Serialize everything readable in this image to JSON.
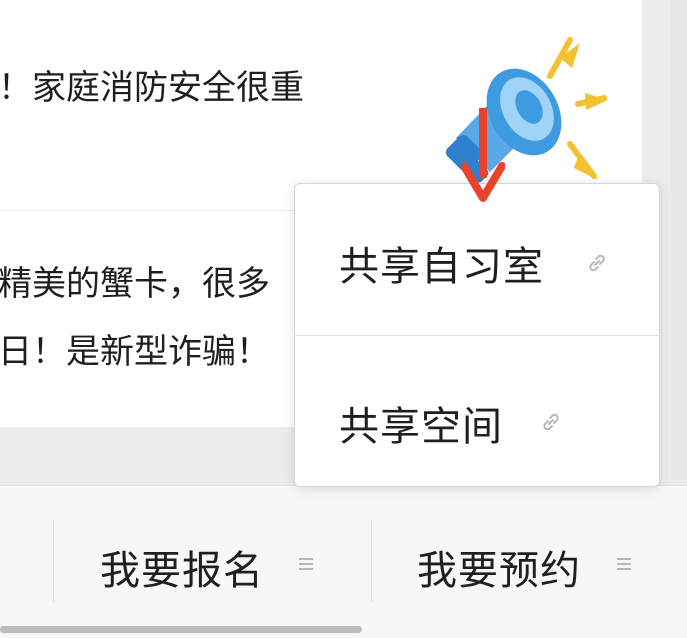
{
  "articles": [
    {
      "lines": [
        "！家庭消防安全很重"
      ]
    },
    {
      "lines": [
        "精美的蟹卡，很多",
        "日！是新型诈骗！"
      ]
    }
  ],
  "popup": {
    "items": [
      {
        "label": "共享自习室",
        "icon": "link-icon"
      },
      {
        "label": "共享空间",
        "icon": "link-icon"
      }
    ]
  },
  "bottom_bar": {
    "tabs": [
      {
        "label": "我要报名",
        "icon": "menu-lines-icon"
      },
      {
        "label": "我要预约",
        "icon": "menu-lines-icon"
      }
    ]
  },
  "colors": {
    "accent_arrow": "#e8442c",
    "megaphone_blue": "#3f9be0",
    "megaphone_rays": "#f2c230",
    "text": "#1f1f1f",
    "icon_gray": "#b8b8b8"
  }
}
